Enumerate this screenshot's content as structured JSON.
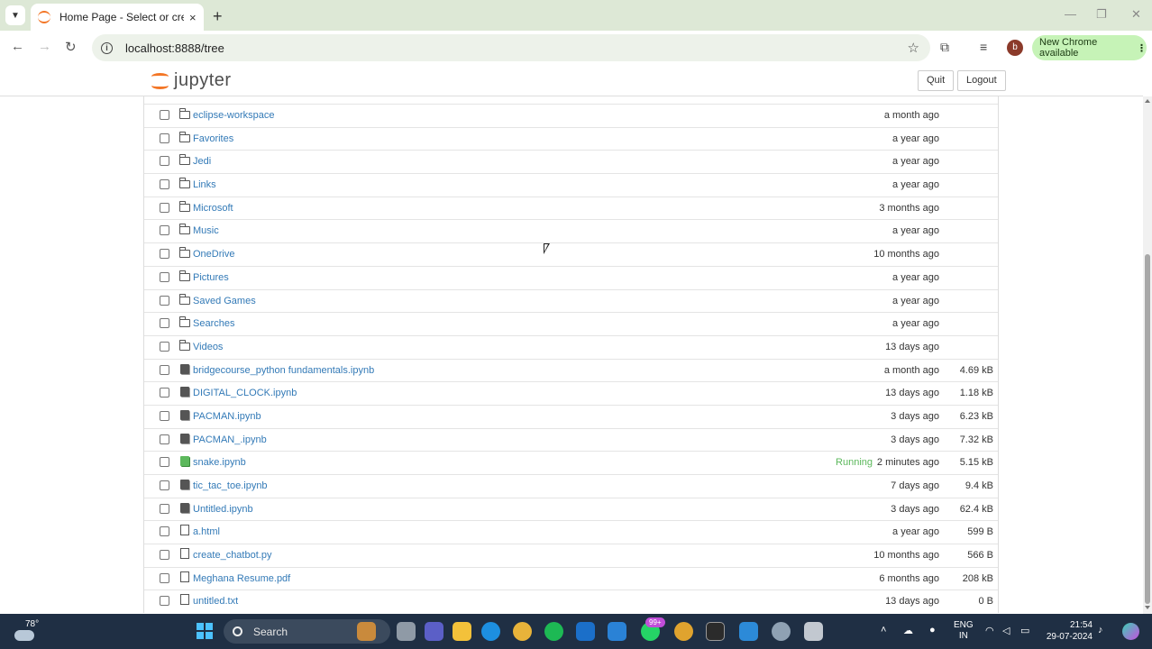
{
  "browser": {
    "tab_title": "Home Page - Select or create a",
    "tab_close": "×",
    "new_tab": "+",
    "url": "localhost:8888/tree",
    "profile_initial": "b",
    "update_label": "New Chrome available",
    "minimize": "—",
    "restore": "❐",
    "close": "✕"
  },
  "jupyter": {
    "logo_text": "jupyter",
    "quit_label": "Quit",
    "logout_label": "Logout"
  },
  "files": [
    {
      "type": "folder",
      "name": "eclipse-workspace",
      "modified": "a month ago",
      "size": "",
      "running": ""
    },
    {
      "type": "folder",
      "name": "Favorites",
      "modified": "a year ago",
      "size": "",
      "running": ""
    },
    {
      "type": "folder",
      "name": "Jedi",
      "modified": "a year ago",
      "size": "",
      "running": ""
    },
    {
      "type": "folder",
      "name": "Links",
      "modified": "a year ago",
      "size": "",
      "running": ""
    },
    {
      "type": "folder",
      "name": "Microsoft",
      "modified": "3 months ago",
      "size": "",
      "running": ""
    },
    {
      "type": "folder",
      "name": "Music",
      "modified": "a year ago",
      "size": "",
      "running": ""
    },
    {
      "type": "folder",
      "name": "OneDrive",
      "modified": "10 months ago",
      "size": "",
      "running": ""
    },
    {
      "type": "folder",
      "name": "Pictures",
      "modified": "a year ago",
      "size": "",
      "running": ""
    },
    {
      "type": "folder",
      "name": "Saved Games",
      "modified": "a year ago",
      "size": "",
      "running": ""
    },
    {
      "type": "folder",
      "name": "Searches",
      "modified": "a year ago",
      "size": "",
      "running": ""
    },
    {
      "type": "folder",
      "name": "Videos",
      "modified": "13 days ago",
      "size": "",
      "running": ""
    },
    {
      "type": "notebook",
      "name": "bridgecourse_python fundamentals.ipynb",
      "modified": "a month ago",
      "size": "4.69 kB",
      "running": ""
    },
    {
      "type": "notebook",
      "name": "DIGITAL_CLOCK.ipynb",
      "modified": "13 days ago",
      "size": "1.18 kB",
      "running": ""
    },
    {
      "type": "notebook",
      "name": "PACMAN.ipynb",
      "modified": "3 days ago",
      "size": "6.23 kB",
      "running": ""
    },
    {
      "type": "notebook",
      "name": "PACMAN_.ipynb",
      "modified": "3 days ago",
      "size": "7.32 kB",
      "running": ""
    },
    {
      "type": "notebook-running",
      "name": "snake.ipynb",
      "modified": "2 minutes ago",
      "size": "5.15 kB",
      "running": "Running"
    },
    {
      "type": "notebook",
      "name": "tic_tac_toe.ipynb",
      "modified": "7 days ago",
      "size": "9.4 kB",
      "running": ""
    },
    {
      "type": "notebook",
      "name": "Untitled.ipynb",
      "modified": "3 days ago",
      "size": "62.4 kB",
      "running": ""
    },
    {
      "type": "file",
      "name": "a.html",
      "modified": "a year ago",
      "size": "599 B",
      "running": ""
    },
    {
      "type": "file",
      "name": "create_chatbot.py",
      "modified": "10 months ago",
      "size": "566 B",
      "running": ""
    },
    {
      "type": "file",
      "name": "Meghana Resume.pdf",
      "modified": "6 months ago",
      "size": "208 kB",
      "running": ""
    },
    {
      "type": "file",
      "name": "untitled.txt",
      "modified": "13 days ago",
      "size": "0 B",
      "running": ""
    }
  ],
  "taskbar": {
    "weather_temp": "78°",
    "search_label": "Search",
    "badge": "99+",
    "lang_line1": "ENG",
    "lang_line2": "IN",
    "time": "21:54",
    "date": "29-07-2024"
  },
  "colors": {
    "chrome_frame": "#dde8d6",
    "link": "#337ab7",
    "running": "#5cb85c",
    "jupyter_orange": "#f37626",
    "taskbar": "#1f2f44"
  }
}
